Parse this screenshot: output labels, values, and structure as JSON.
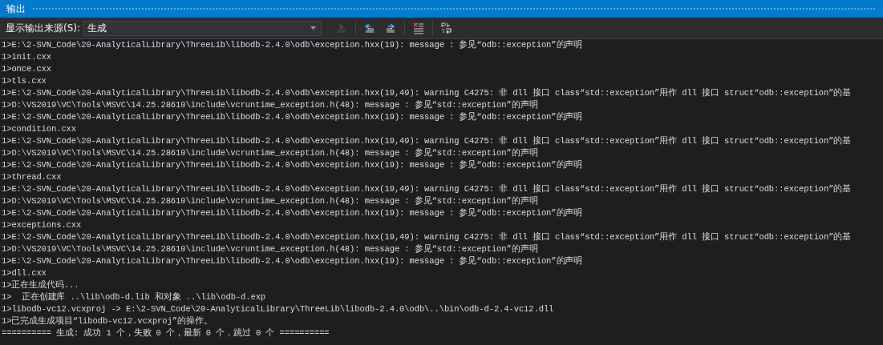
{
  "window": {
    "title": "输出"
  },
  "toolbar": {
    "source_label": "显示输出来源(S):",
    "source_value": "生成",
    "buttons": [
      {
        "kind": "goto",
        "disabled": true
      },
      {
        "kind": "prev",
        "disabled": false
      },
      {
        "kind": "next",
        "disabled": false
      },
      {
        "kind": "clear",
        "disabled": false
      },
      {
        "kind": "wrap",
        "disabled": false
      }
    ]
  },
  "lines": [
    "1>E:\\2-SVN_Code\\20-AnalyticalLibrary\\ThreeLib\\libodb-2.4.0\\odb\\exception.hxx(19): message : 参见“odb::exception”的声明",
    "1>init.cxx",
    "1>once.cxx",
    "1>tls.cxx",
    "1>E:\\2-SVN_Code\\20-AnalyticalLibrary\\ThreeLib\\libodb-2.4.0\\odb\\exception.hxx(19,49): warning C4275: 非 dll 接口 class“std::exception”用作 dll 接口 struct“odb::exception”的基",
    "1>D:\\VS2019\\VC\\Tools\\MSVC\\14.25.28610\\include\\vcruntime_exception.h(48): message : 参见“std::exception”的声明",
    "1>E:\\2-SVN_Code\\20-AnalyticalLibrary\\ThreeLib\\libodb-2.4.0\\odb\\exception.hxx(19): message : 参见“odb::exception”的声明",
    "1>condition.cxx",
    "1>E:\\2-SVN_Code\\20-AnalyticalLibrary\\ThreeLib\\libodb-2.4.0\\odb\\exception.hxx(19,49): warning C4275: 非 dll 接口 class“std::exception”用作 dll 接口 struct“odb::exception”的基",
    "1>D:\\VS2019\\VC\\Tools\\MSVC\\14.25.28610\\include\\vcruntime_exception.h(48): message : 参见“std::exception”的声明",
    "1>E:\\2-SVN_Code\\20-AnalyticalLibrary\\ThreeLib\\libodb-2.4.0\\odb\\exception.hxx(19): message : 参见“odb::exception”的声明",
    "1>thread.cxx",
    "1>E:\\2-SVN_Code\\20-AnalyticalLibrary\\ThreeLib\\libodb-2.4.0\\odb\\exception.hxx(19,49): warning C4275: 非 dll 接口 class“std::exception”用作 dll 接口 struct“odb::exception”的基",
    "1>D:\\VS2019\\VC\\Tools\\MSVC\\14.25.28610\\include\\vcruntime_exception.h(48): message : 参见“std::exception”的声明",
    "1>E:\\2-SVN_Code\\20-AnalyticalLibrary\\ThreeLib\\libodb-2.4.0\\odb\\exception.hxx(19): message : 参见“odb::exception”的声明",
    "1>exceptions.cxx",
    "1>E:\\2-SVN_Code\\20-AnalyticalLibrary\\ThreeLib\\libodb-2.4.0\\odb\\exception.hxx(19,49): warning C4275: 非 dll 接口 class“std::exception”用作 dll 接口 struct“odb::exception”的基",
    "1>D:\\VS2019\\VC\\Tools\\MSVC\\14.25.28610\\include\\vcruntime_exception.h(48): message : 参见“std::exception”的声明",
    "1>E:\\2-SVN_Code\\20-AnalyticalLibrary\\ThreeLib\\libodb-2.4.0\\odb\\exception.hxx(19): message : 参见“odb::exception”的声明",
    "1>dll.cxx",
    "1>正在生成代码...",
    "1>  正在创建库 ..\\lib\\odb-d.lib 和对象 ..\\lib\\odb-d.exp",
    "1>libodb-vc12.vcxproj -> E:\\2-SVN_Code\\20-AnalyticalLibrary\\ThreeLib\\libodb-2.4.0\\odb\\..\\bin\\odb-d-2.4-vc12.dll",
    "1>已完成生成项目“libodb-vc12.vcxproj”的操作。",
    "========== 生成: 成功 1 个，失败 0 个，最新 0 个，跳过 0 个 =========="
  ]
}
